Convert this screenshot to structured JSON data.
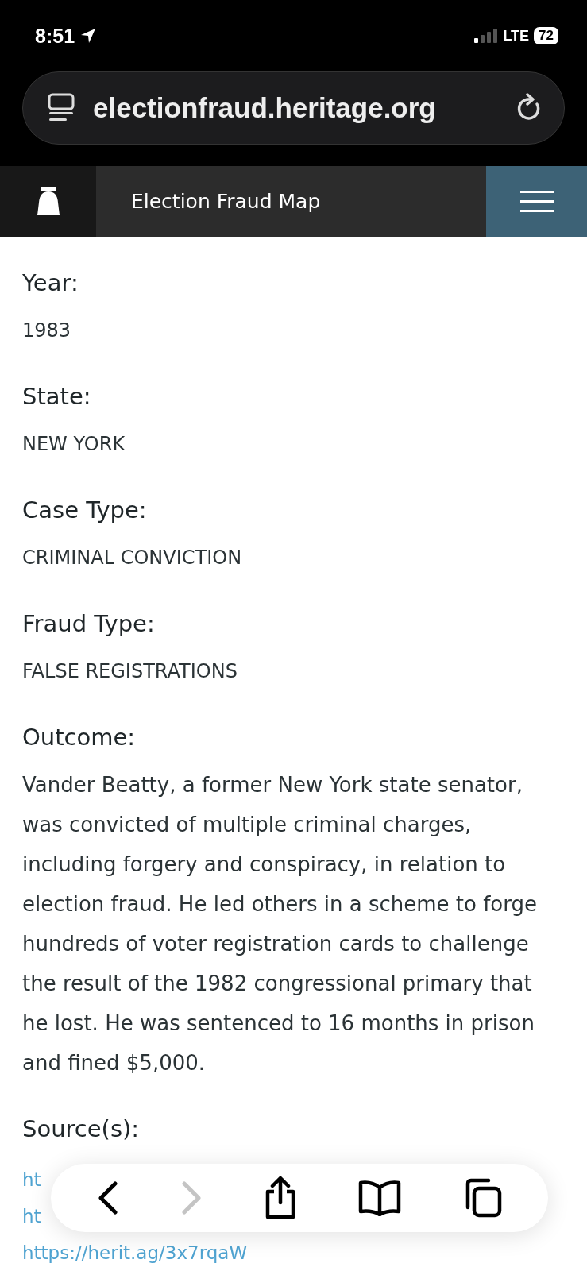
{
  "status_bar": {
    "time": "8:51",
    "network": "LTE",
    "battery": "72"
  },
  "address_bar": {
    "url": "electionfraud.heritage.org"
  },
  "site_header": {
    "title": "Election Fraud Map"
  },
  "case": {
    "fields": [
      {
        "label": "Year:",
        "value": "1983"
      },
      {
        "label": "State:",
        "value": "NEW YORK"
      },
      {
        "label": "Case Type:",
        "value": "CRIMINAL CONVICTION"
      },
      {
        "label": "Fraud Type:",
        "value": "FALSE REGISTRATIONS"
      },
      {
        "label": "Outcome:",
        "value": "Vander Beatty, a former New York state senator, was convicted of multiple criminal charges, including forgery and conspiracy, in relation to election fraud. He led others in a scheme to forge hundreds of voter registration cards to challenge the result of the 1982 congressional primary that he lost. He was sentenced to 16 months in prison and fined $5,000."
      }
    ],
    "sources": {
      "label": "Source(s):",
      "links": [
        "ht",
        "ht",
        "https://herit.ag/3x7rqaW"
      ]
    }
  },
  "toolbar": {
    "buttons": [
      {
        "kind": "back",
        "disabled": false
      },
      {
        "kind": "forward",
        "disabled": true
      },
      {
        "kind": "share",
        "disabled": false
      },
      {
        "kind": "bookmarks",
        "disabled": false
      },
      {
        "kind": "tabs",
        "disabled": false
      }
    ]
  }
}
